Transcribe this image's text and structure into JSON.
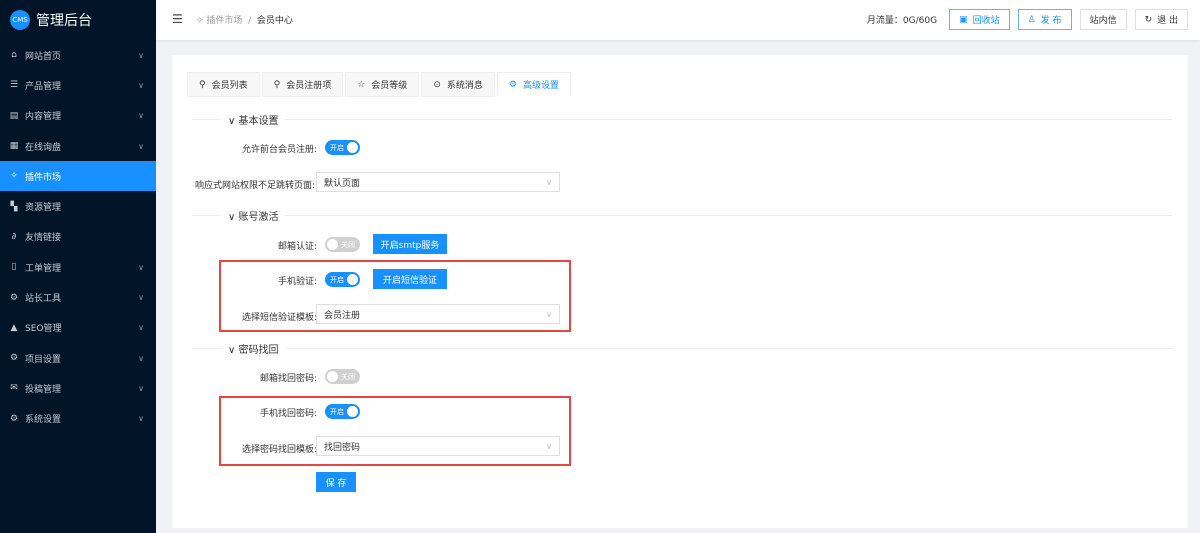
{
  "app": {
    "logo": "CMS",
    "title": "管理后台"
  },
  "sidebar": {
    "items": [
      {
        "label": "网站首页",
        "icon": "home-icon",
        "glyph": "⌂",
        "chev": true
      },
      {
        "label": "产品管理",
        "icon": "list-icon",
        "glyph": "☰",
        "chev": true
      },
      {
        "label": "内容管理",
        "icon": "content-icon",
        "glyph": "▤",
        "chev": true
      },
      {
        "label": "在线询盘",
        "icon": "table-icon",
        "glyph": "▦",
        "chev": true
      },
      {
        "label": "插件市场",
        "icon": "pin-icon",
        "glyph": "✧",
        "chev": false,
        "active": true
      },
      {
        "label": "资源管理",
        "icon": "grid-icon",
        "glyph": "▚",
        "chev": false
      },
      {
        "label": "友情链接",
        "icon": "link-icon",
        "glyph": "∂",
        "chev": false
      },
      {
        "label": "工单管理",
        "icon": "ticket-icon",
        "glyph": "▯",
        "chev": true
      },
      {
        "label": "站长工具",
        "icon": "tools-icon",
        "glyph": "⚙",
        "chev": true
      },
      {
        "label": "SEO管理",
        "icon": "warning-icon",
        "glyph": "▲",
        "chev": true
      },
      {
        "label": "项目设置",
        "icon": "settings-icon",
        "glyph": "⚙",
        "chev": true
      },
      {
        "label": "投稿管理",
        "icon": "mail-icon",
        "glyph": "✉",
        "chev": true
      },
      {
        "label": "系统设置",
        "icon": "settings-icon",
        "glyph": "⚙",
        "chev": true
      }
    ]
  },
  "header": {
    "breadcrumb": [
      "插件市场",
      "会员中心"
    ],
    "traffic": "月流量：0G/60G",
    "recycle": "回收站",
    "publish": "发 布",
    "messages": "站内信",
    "logout": "退 出"
  },
  "tabs": [
    {
      "label": "会员列表",
      "glyph": "⚲"
    },
    {
      "label": "会员注册项",
      "glyph": "⚲"
    },
    {
      "label": "会员等级",
      "glyph": "☆"
    },
    {
      "label": "系统消息",
      "glyph": "⊙"
    },
    {
      "label": "高级设置",
      "glyph": "⚙",
      "active": true
    }
  ],
  "form": {
    "sec_basic": "基本设置",
    "allow_reg_label": "允许前台会员注册:",
    "allow_reg": "开启",
    "redirect_label": "响应式网站权限不足跳转页面:",
    "redirect_value": "默认页面",
    "sec_activate": "账号激活",
    "email_verify_label": "邮箱认证:",
    "email_verify": "关闭",
    "smtp_btn": "开启smtp服务",
    "phone_verify_label": "手机验证:",
    "phone_verify": "开启",
    "sms_btn": "开启短信验证",
    "sms_tpl_label": "选择短信验证模板:",
    "sms_tpl_value": "会员注册",
    "sec_recover": "密码找回",
    "email_recover_label": "邮箱找回密码:",
    "email_recover": "关闭",
    "phone_recover_label": "手机找回密码:",
    "phone_recover": "开启",
    "recover_tpl_label": "选择密码找回模板:",
    "recover_tpl_value": "找回密码",
    "save": "保 存"
  }
}
